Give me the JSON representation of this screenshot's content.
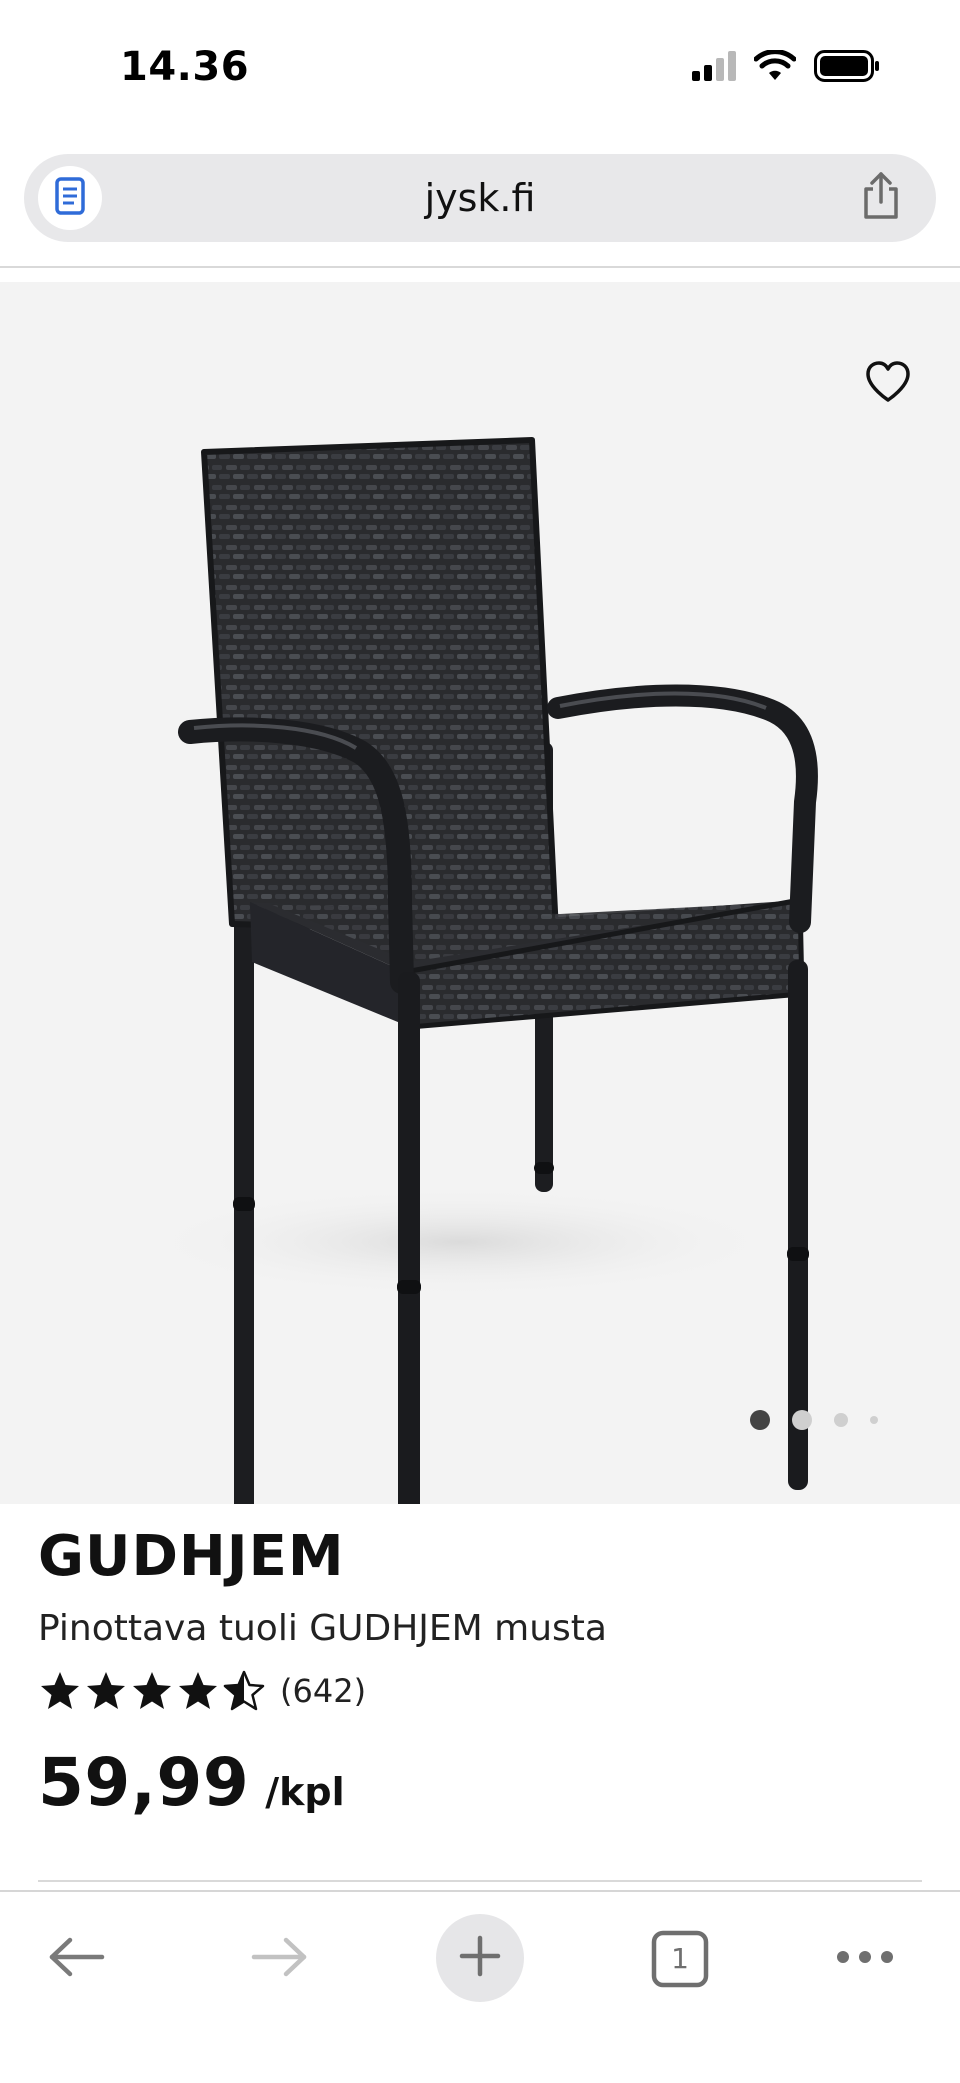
{
  "status_bar": {
    "time": "14.36",
    "icons": [
      "cellular-signal-icon",
      "wifi-icon",
      "battery-icon"
    ]
  },
  "browser": {
    "url": "jysk.fi",
    "reader_icon": "reader-mode-icon",
    "share_icon": "share-icon"
  },
  "product": {
    "image_alt": "Pinottava tuoli GUDHJEM musta",
    "wishlist_icon": "heart-icon",
    "carousel": {
      "total": 4,
      "active": 1
    },
    "name": "GUDHJEM",
    "description": "Pinottava tuoli GUDHJEM musta",
    "rating": 4.5,
    "review_count": "(642)",
    "price": "59,99",
    "unit": "/kpl"
  },
  "toolbar": {
    "buttons": [
      "back-arrow-icon",
      "forward-arrow-icon",
      "new-tab-plus-icon",
      "tabs-icon",
      "more-icon"
    ],
    "tab_count": "1"
  },
  "colors": {
    "image_background": "#f3f3f3",
    "address_bar": "#e8e8ea",
    "reader_icon_blue": "#2f6bd8",
    "text": "#111111"
  }
}
